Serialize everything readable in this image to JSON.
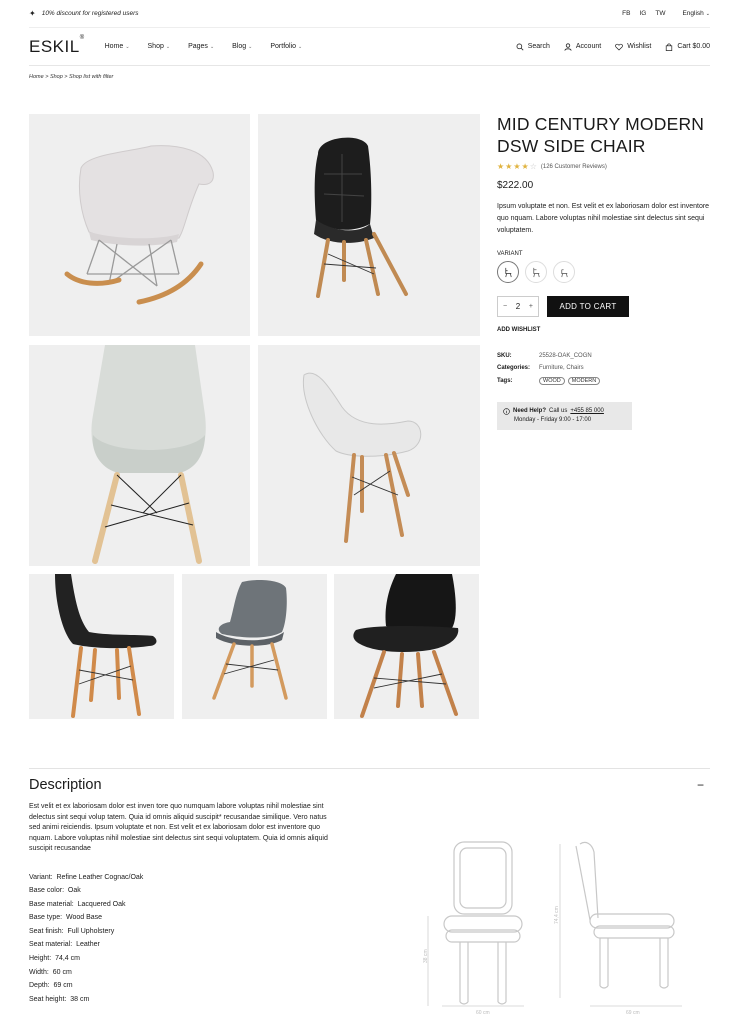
{
  "topbar": {
    "promo": "10% discount for registered users",
    "social": [
      "FB",
      "IG",
      "TW"
    ],
    "language": "English"
  },
  "header": {
    "logo": "ESKIL",
    "logo_mark": "®",
    "nav": [
      "Home",
      "Shop",
      "Pages",
      "Blog",
      "Portfolio"
    ],
    "search": "Search",
    "account": "Account",
    "wishlist": "Wishlist",
    "cart": "Cart $0.00"
  },
  "breadcrumb": "Home > Shop > Shop list with filter",
  "product": {
    "title": "MID CENTURY MODERN DSW SIDE CHAIR",
    "rating": 3.5,
    "reviews": "(126 Customer Reviews)",
    "price": "$222.00",
    "description": "Ipsum voluptate et non. Est velit et ex laboriosam dolor est inventore quo nquam. Labore voluptas nihil molestiae sint delectus sint sequi voluptatem.",
    "variant_label": "VARIANT",
    "variants": [
      "chair-a-icon",
      "chair-b-icon",
      "chair-c-icon"
    ],
    "quantity": "2",
    "qty_minus": "−",
    "qty_plus": "+",
    "add_to_cart": "ADD TO CART",
    "add_wishlist": "ADD WISHLIST",
    "sku_label": "SKU:",
    "sku": "25528-OAK_COGN",
    "categories_label": "Categories:",
    "categories": "Furniture, Chairs",
    "tags_label": "Tags:",
    "tags": [
      "WOOD",
      "MODERN"
    ],
    "help_label": "Need Help?",
    "help_call": "Call us",
    "help_phone": "+455 85 000",
    "help_hours": "Monday - Friday 9:00 - 17:00"
  },
  "description": {
    "title": "Description",
    "toggle": "−",
    "body": "Est velit et ex laboriosam dolor est inven tore quo numquam labore voluptas nihil molestiae sint delectus sint sequi volup tatem. Quia id omnis aliquid suscipit* recusandae similique. Vero natus sed animi reiciendis. Ipsum voluptate et non. Est velit et ex laboriosam dolor est inventore quo nquam. Labore voluptas nihil molestiae sint delectus sint sequi voluptatem. Quia id omnis aliquid suscipit recusandae",
    "specs": [
      {
        "k": "Variant:",
        "v": "Refine Leather Cognac/Oak"
      },
      {
        "k": "Base color:",
        "v": "Oak"
      },
      {
        "k": "Base material:",
        "v": "Lacquered Oak"
      },
      {
        "k": "Base type:",
        "v": "Wood Base"
      },
      {
        "k": "Seat finish:",
        "v": "Full Upholstery"
      },
      {
        "k": "Seat material:",
        "v": "Leather"
      },
      {
        "k": "Height:",
        "v": "74,4 cm"
      },
      {
        "k": "Width:",
        "v": "60 cm"
      },
      {
        "k": "Depth:",
        "v": "69 cm"
      },
      {
        "k": "Seat height:",
        "v": "38 cm"
      }
    ],
    "dims": {
      "width": "60 cm",
      "depth": "69 cm",
      "height": "74,4 cm",
      "seat": "38 cm"
    }
  },
  "colors": {
    "accent": "#111111",
    "star": "#e0b33f",
    "tile_bg": "#efefef"
  }
}
